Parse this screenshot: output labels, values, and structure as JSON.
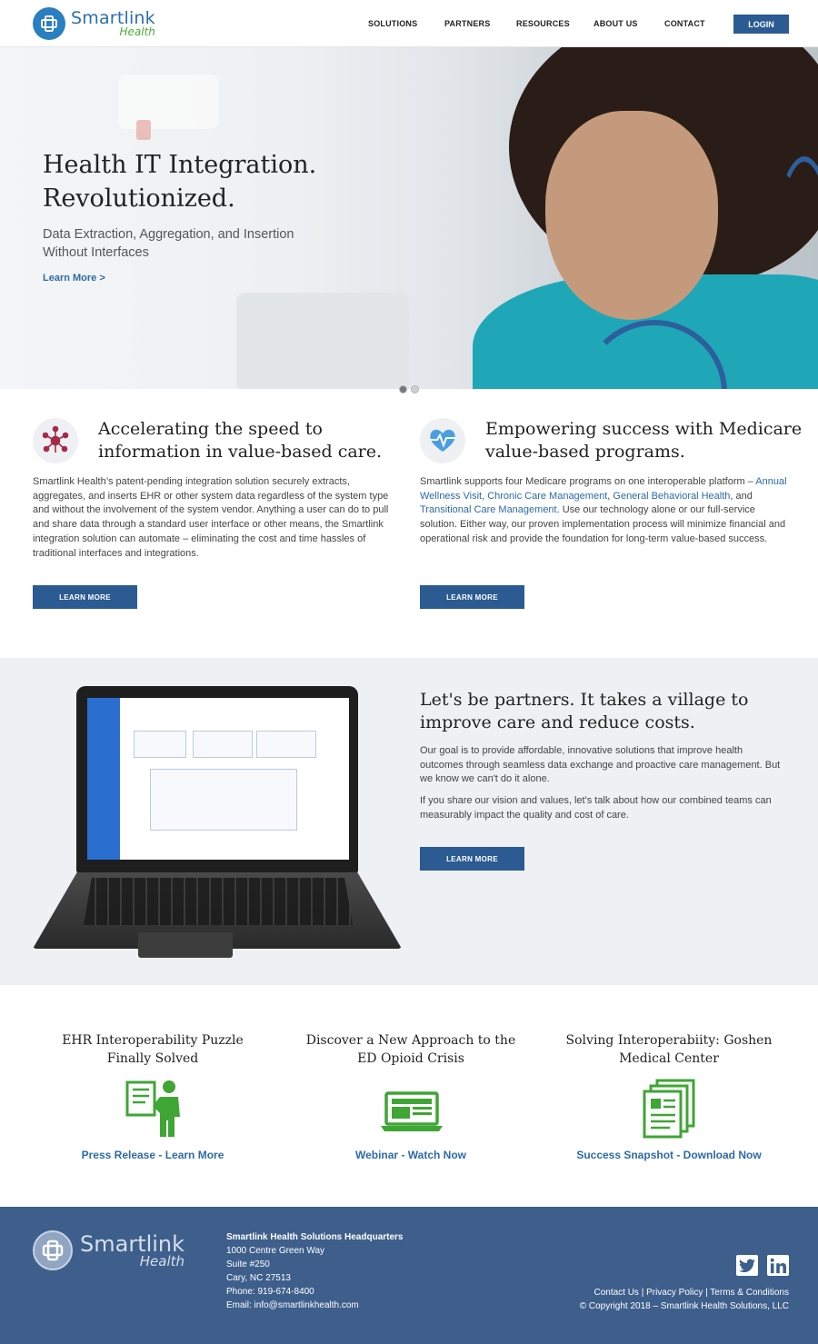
{
  "brand": {
    "name_line1": "Smartlink",
    "name_line2": "Health"
  },
  "nav": {
    "items": [
      "SOLUTIONS",
      "PARTNERS",
      "RESOURCES",
      "ABOUT US",
      "CONTACT"
    ],
    "login_label": "LOGIN"
  },
  "hero": {
    "title_line1": "Health IT Integration.",
    "title_line2": "Revolutionized.",
    "subtitle_line1": "Data Extraction, Aggregation, and Insertion",
    "subtitle_line2": "Without Interfaces",
    "link": "Learn More >",
    "slides": 2,
    "active_slide": 1
  },
  "props": [
    {
      "icon": "network-nodes-icon",
      "title": "Accelerating the speed to information in value-based care.",
      "body": "Smartlink Health’s patent-pending integration solution securely extracts, aggregates, and inserts EHR or other system data regardless of the system type and without the involvement of the system vendor. Anything a user can do to pull and share data through a standard user interface or other means, the Smartlink integration solution can automate – eliminating the cost and time hassles of traditional interfaces and integrations.",
      "button": "LEARN MORE"
    },
    {
      "icon": "heart-pulse-icon",
      "title": "Empowering success with Medicare value-based programs.",
      "body_before": "Smartlink supports four Medicare programs on one interoperable platform – ",
      "link1": "Annual Wellness Visit",
      "sep1": ", ",
      "link2": "Chronic Care Management",
      "sep2": ", ",
      "link3": "General Behavioral Health",
      "sep3": ", and ",
      "link4": "Transitional Care Management",
      "body_after": ". Use our technology alone or our full-service solution. Either way, our proven implementation process will minimize financial and operational risk and provide the foundation for long-term value-based success.",
      "button": "LEARN MORE"
    }
  ],
  "partners": {
    "title": "Let's be partners. It takes a village to improve care and reduce costs.",
    "para1": "Our goal is to provide affordable, innovative solutions that improve health outcomes through seamless data exchange and proactive care management. But we know we can't do it alone.",
    "para2": "If you share our vision and values, let's talk about how our combined teams can measurably impact the quality and cost of care.",
    "button": "LEARN MORE"
  },
  "resources": [
    {
      "title": "EHR Interoperability Puzzle Finally Solved",
      "link": "Press Release - Learn More",
      "icon": "presenter-icon"
    },
    {
      "title": "Discover a New Approach to the ED Opioid Crisis",
      "link": "Webinar - Watch Now",
      "icon": "laptop-icon"
    },
    {
      "title": "Solving Interoperabiity: Goshen Medical Center",
      "link": "Success Snapshot - Download Now",
      "icon": "documents-icon"
    }
  ],
  "colors": {
    "brand_blue": "#2b5b92",
    "footer_bg": "#3e5f8c",
    "link_blue": "#2d6aa8",
    "icon_green": "#3fa535"
  },
  "footer": {
    "hq_title": "Smartlink Health Solutions Headquarters",
    "address1": "1000 Centre Green Way",
    "address2": "Suite #250",
    "address3": "Cary, NC 27513",
    "phone": "Phone: 919-674-8400",
    "email": "Email: info@smartlinkhealth.com",
    "links": "Contact Us | Privacy Policy | Terms & Conditions",
    "copyright": "© Copyright 2018 – Smartlink Health Solutions, LLC"
  }
}
